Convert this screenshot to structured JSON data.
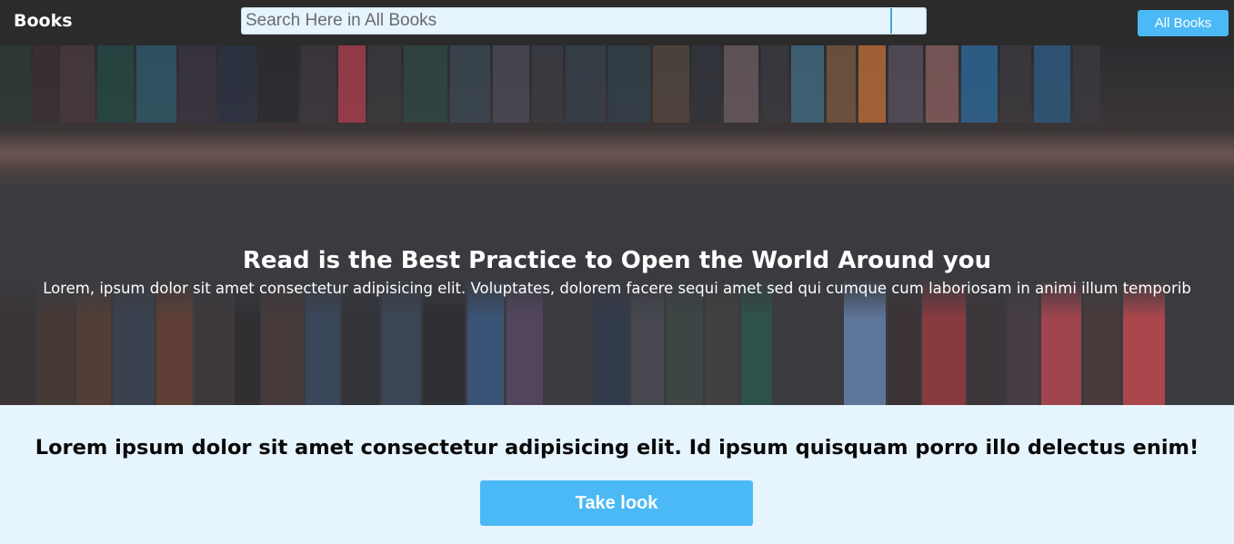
{
  "navbar": {
    "brand": "Books",
    "search": {
      "placeholder": "Search Here in All Books",
      "value": ""
    },
    "all_books_label": "All Books"
  },
  "hero": {
    "title": "Read is the Best Practice to Open the World Around you",
    "subtitle": "Lorem, ipsum dolor sit amet consectetur adipisicing elit. Voluptates, dolorem facere sequi amet sed qui cumque cum laboriosam in animi illum temporib"
  },
  "cta": {
    "heading": "Lorem ipsum dolor sit amet consectetur adipisicing elit. Id ipsum quisquam porro illo delectus enim!",
    "button_label": "Take look"
  },
  "colors": {
    "navbar_bg": "#2b2b2b",
    "accent": "#4bb9f5",
    "page_bg": "#e6f4fd"
  },
  "images": {
    "hero_background": "bookshelf-photo"
  }
}
